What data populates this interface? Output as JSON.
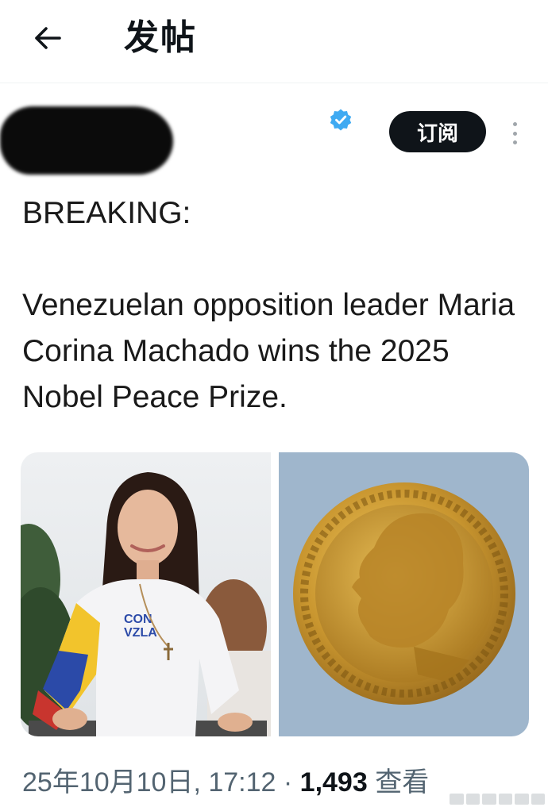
{
  "header": {
    "title": "发帖"
  },
  "author": {
    "subscribe_label": "订阅"
  },
  "tweet": {
    "line_breaking": "BREAKING:",
    "body": "Venezuelan opposition leader Maria Corina Machado wins the 2025 Nobel Peace Prize."
  },
  "meta": {
    "timestamp": "25年10月10日, 17:12",
    "separator": "·",
    "views_count": "1,493",
    "views_label": "查看"
  },
  "colors": {
    "text": "#0f1419",
    "muted": "#536471",
    "verified_blue": "#1d9bf0",
    "button_bg": "#0f1419",
    "medal_bg": "#9fb6cc",
    "gold": "#c9962f"
  },
  "icons": {
    "back": "arrow-left-icon",
    "verified": "verified-badge-icon",
    "more": "more-vertical-icon"
  }
}
